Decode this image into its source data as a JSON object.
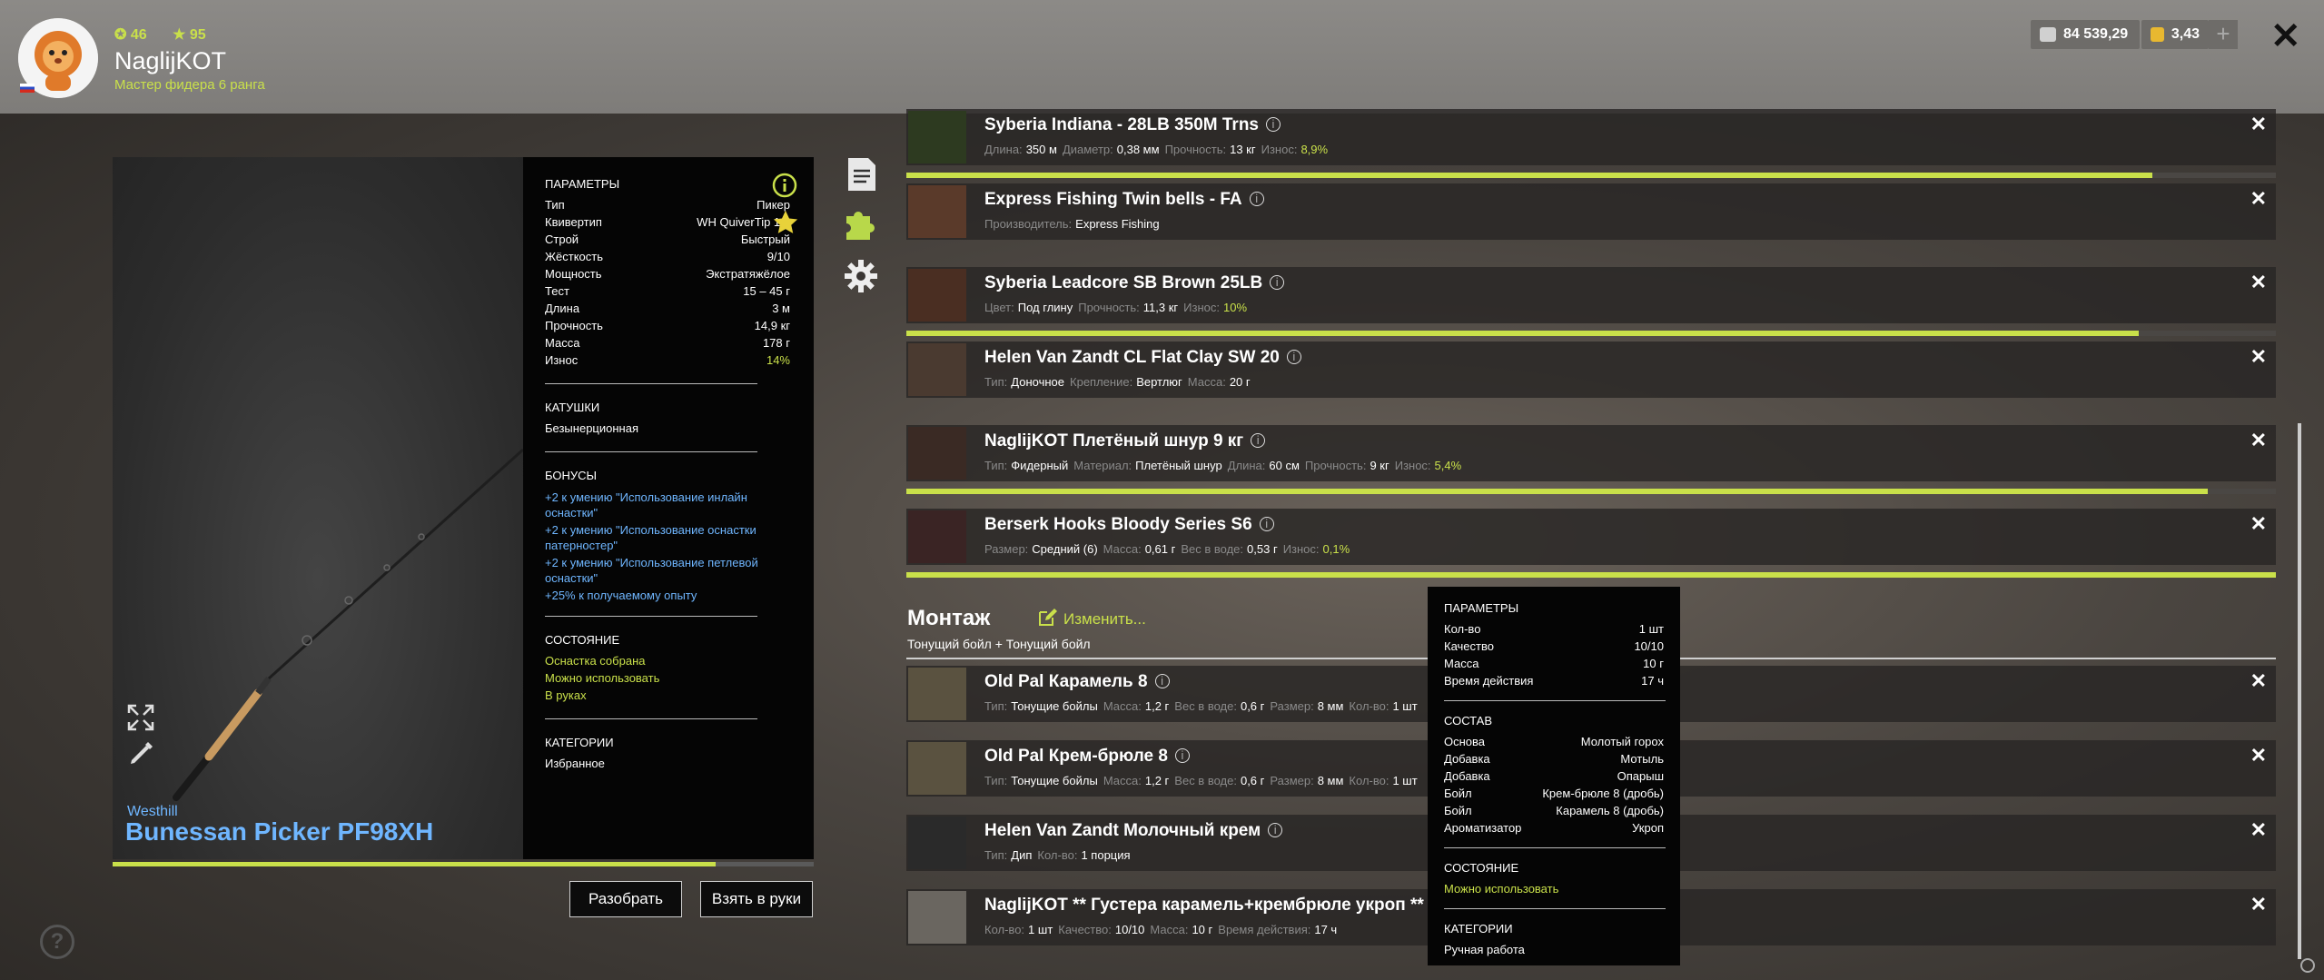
{
  "user": {
    "stat1": "46",
    "stat2": "95",
    "name": "NaglijKOT",
    "rank": "Мастер фидера 6 ранга"
  },
  "currency": {
    "silver": "84 539,29",
    "gold": "3,43"
  },
  "rod": {
    "brand": "Westhill",
    "name": "Bunessan Picker PF98XH",
    "wear_fraction": 0.86
  },
  "specs": {
    "params_title": "ПАРАМЕТРЫ",
    "params": [
      {
        "k": "Тип",
        "v": "Пикер"
      },
      {
        "k": "Квивертип",
        "v": "WH QuiverTip 1.0"
      },
      {
        "k": "Строй",
        "v": "Быстрый"
      },
      {
        "k": "Жёсткость",
        "v": "9/10"
      },
      {
        "k": "Мощность",
        "v": "Экстратяжёлое"
      },
      {
        "k": "Тест",
        "v": "15 – 45 г"
      },
      {
        "k": "Длина",
        "v": "3 м"
      },
      {
        "k": "Прочность",
        "v": "14,9 кг"
      },
      {
        "k": "Масса",
        "v": "178 г"
      },
      {
        "k": "Износ",
        "v": "14%"
      }
    ],
    "reels_title": "КАТУШКИ",
    "reel": "Безынерционная",
    "bonus_title": "БОНУСЫ",
    "bonuses": [
      "+2 к умению \"Использование инлайн оснастки\"",
      "+2 к умению \"Использование оснастки патерностер\"",
      "+2 к умению \"Использование петлевой оснастки\"",
      "+25% к получаемому опыту"
    ],
    "state_title": "СОСТОЯНИЕ",
    "states": [
      "Оснастка собрана",
      "Можно использовать",
      "В руках"
    ],
    "cat_title": "КАТЕГОРИИ",
    "category": "Избранное"
  },
  "buttons": {
    "disassemble": "Разобрать",
    "take": "Взять в руки"
  },
  "tackle": [
    {
      "title": "Syberia Indiana - 28LB 350M Trns",
      "props": [
        {
          "k": "Длина:",
          "v": "350 м"
        },
        {
          "k": "Диаметр:",
          "v": "0,38 мм"
        },
        {
          "k": "Прочность:",
          "v": "13 кг"
        },
        {
          "k": "Износ:",
          "v": "8,9%",
          "g": true
        }
      ],
      "bar": 0.91
    },
    {
      "title": "Express Fishing Twin bells - FA",
      "props": [
        {
          "k": "Производитель:",
          "v": "Express Fishing"
        }
      ]
    },
    {
      "title": "Syberia Leadcore SB Brown 25LB",
      "props": [
        {
          "k": "Цвет:",
          "v": "Под глину"
        },
        {
          "k": "Прочность:",
          "v": "11,3 кг"
        },
        {
          "k": "Износ:",
          "v": "10%",
          "g": true
        }
      ],
      "bar": 0.9
    },
    {
      "title": "Helen Van Zandt CL Flat Clay SW 20",
      "props": [
        {
          "k": "Тип:",
          "v": "Доночное"
        },
        {
          "k": "Крепление:",
          "v": "Вертлюг"
        },
        {
          "k": "Масса:",
          "v": "20 г"
        }
      ]
    },
    {
      "title": "NaglijKOT Плетёный шнур 9 кг",
      "props": [
        {
          "k": "Тип:",
          "v": "Фидерный"
        },
        {
          "k": "Материал:",
          "v": "Плетёный шнур"
        },
        {
          "k": "Длина:",
          "v": "60 см"
        },
        {
          "k": "Прочность:",
          "v": "9 кг"
        },
        {
          "k": "Износ:",
          "v": "5,4%",
          "g": true
        }
      ],
      "bar": 0.95
    },
    {
      "title": "Berserk Hooks Bloody Series S6",
      "props": [
        {
          "k": "Размер:",
          "v": "Средний (6)"
        },
        {
          "k": "Масса:",
          "v": "0,61 г"
        },
        {
          "k": "Вес в воде:",
          "v": "0,53 г"
        },
        {
          "k": "Износ:",
          "v": "0,1%",
          "g": true
        }
      ],
      "bar": 1.0
    }
  ],
  "montage": {
    "title": "Монтаж",
    "edit": "Изменить...",
    "subtitle": "Тонущий бойл  +  Тонущий бойл"
  },
  "baits": [
    {
      "title": "Old Pal Карамель 8",
      "props": [
        {
          "k": "Тип:",
          "v": "Тонущие бойлы"
        },
        {
          "k": "Масса:",
          "v": "1,2 г"
        },
        {
          "k": "Вес в воде:",
          "v": "0,6 г"
        },
        {
          "k": "Размер:",
          "v": "8 мм"
        },
        {
          "k": "Кол-во:",
          "v": "1 шт"
        }
      ]
    },
    {
      "title": "Old Pal Крем-брюле 8",
      "props": [
        {
          "k": "Тип:",
          "v": "Тонущие бойлы"
        },
        {
          "k": "Масса:",
          "v": "1,2 г"
        },
        {
          "k": "Вес в воде:",
          "v": "0,6 г"
        },
        {
          "k": "Размер:",
          "v": "8 мм"
        },
        {
          "k": "Кол-во:",
          "v": "1 шт"
        }
      ]
    },
    {
      "title": "Helen Van Zandt Молочный крем",
      "props": [
        {
          "k": "Тип:",
          "v": "Дип"
        },
        {
          "k": "Кол-во:",
          "v": "1 порция"
        }
      ]
    },
    {
      "title": "NaglijKOT ** Густера карамель+крембрюле укроп **",
      "props": [
        {
          "k": "Кол-во:",
          "v": "1 шт"
        },
        {
          "k": "Качество:",
          "v": "10/10"
        },
        {
          "k": "Масса:",
          "v": "10 г"
        },
        {
          "k": "Время действия:",
          "v": "17 ч"
        }
      ]
    }
  ],
  "tooltip": {
    "params_title": "ПАРАМЕТРЫ",
    "params": [
      {
        "k": "Кол-во",
        "v": "1 шт"
      },
      {
        "k": "Качество",
        "v": "10/10"
      },
      {
        "k": "Масса",
        "v": "10 г"
      },
      {
        "k": "Время действия",
        "v": "17 ч"
      }
    ],
    "comp_title": "СОСТАВ",
    "comp": [
      {
        "k": "Основа",
        "v": "Молотый горох"
      },
      {
        "k": "Добавка",
        "v": "Мотыль"
      },
      {
        "k": "Добавка",
        "v": "Опарыш"
      },
      {
        "k": "Бойл",
        "v": "Крем-брюле 8 (дробь)"
      },
      {
        "k": "Бойл",
        "v": "Карамель 8 (дробь)"
      },
      {
        "k": "Ароматизатор",
        "v": "Укроп"
      }
    ],
    "state_title": "СОСТОЯНИЕ",
    "state": "Можно использовать",
    "cat_title": "КАТЕГОРИИ",
    "category": "Ручная работа"
  },
  "colors": {
    "accent": "#c9e04a",
    "link": "#6fb6ff"
  }
}
